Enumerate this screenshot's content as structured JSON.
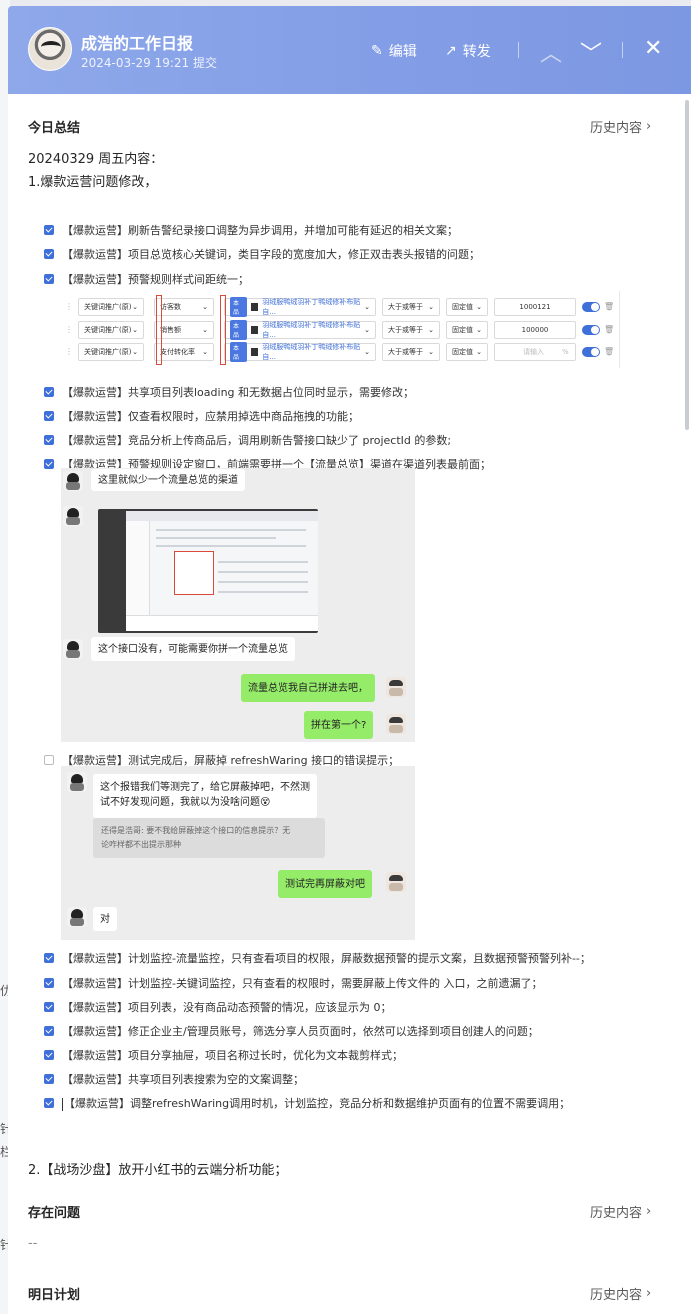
{
  "header": {
    "title": "成浩的工作日报",
    "subtitle": "2024-03-29 19:21 提交",
    "edit_label": "编辑",
    "forward_label": "转发",
    "up_icon": "chevron-up-icon",
    "down_icon": "chevron-down-icon",
    "close_icon": "close-icon"
  },
  "colors": {
    "header_bg": "#839ee6",
    "checkbox": "#3f6fd8",
    "bubble_green": "#95ec69",
    "chat_bg": "#ededed"
  },
  "background_fragments": [
    "仂",
    "针",
    "栏",
    "针"
  ],
  "today": {
    "title": "今日总结",
    "history": "历史内容",
    "date_line": "20240329 周五内容：",
    "item1": "1.爆款运营问题修改，",
    "tasks_a": [
      "【爆款运营】刷新告警纪录接口调整为异步调用，并增加可能有延迟的相关文案；",
      "【爆款运营】项目总览核心关键词，类目字段的宽度加大，修正双击表头报错的问题；",
      "【爆款运营】预警规则样式间距统一；"
    ],
    "rules": [
      {
        "field": "关键词推广(原)",
        "metric": "访客数",
        "tag": "本品",
        "link": "羽绒服鸭绒羽补丁鸭绒修补布贴自...",
        "op": "大于或等于",
        "mode": "固定值",
        "value": "1000121"
      },
      {
        "field": "关键词推广(原)",
        "metric": "销售额",
        "tag": "本品",
        "link": "羽绒服鸭绒羽补丁鸭绒修补布贴自...",
        "op": "大于或等于",
        "mode": "固定值",
        "value": "100000"
      },
      {
        "field": "关键词推广(原)",
        "metric": "支付转化率",
        "tag": "本品",
        "link": "羽绒服鸭绒羽补丁鸭绒修补布贴自...",
        "op": "大于或等于",
        "mode": "固定值",
        "value": "",
        "placeholder": "请输入",
        "unit": "%"
      }
    ],
    "tasks_b": [
      "【爆款运营】共享项目列表loading 和无数据占位同时显示，需要修改；",
      "【爆款运营】仅查看权限时，应禁用掉选中商品拖拽的功能；",
      "【爆款运营】竞品分析上传商品后，调用刷新告警接口缺少了 projectId 的参数;",
      "【爆款运营】预警规则设定窗口，前端需要拼一个【流量总览】渠道在渠道列表最前面；"
    ],
    "chat1": {
      "msg1": "这里就似少一个流量总览的渠道",
      "msg2": "这个接口没有，可能需要你拼一个流量总览",
      "reply1": "流量总览我自己拼进去吧，",
      "reply2": "拼在第一个?"
    },
    "task_unchecked": "【爆款运营】测试完成后，屏蔽掉 refreshWaring 接口的错误提示；",
    "chat2": {
      "msg1_line1": "这个报错我们等测完了，给它屏蔽掉吧，不然测",
      "msg1_line2": "试不好发现问题，我就以为没啥问题😵",
      "quote_line1": "还得是浩哥: 要不我给屏蔽掉这个接口的信息提示？无",
      "quote_line2": "论咋样都不出提示那种",
      "reply": "测试完再屏蔽对吧",
      "msg2": "对"
    },
    "tasks_c": [
      "【爆款运营】计划监控-流量监控，只有查看项目的权限，屏蔽数据预警的提示文案，且数据预警预警列补--；",
      "【爆款运营】计划监控-关键词监控，只有查看的权限时，需要屏蔽上传文件的 入口，之前遗漏了；",
      "【爆款运营】项目列表，没有商品动态预警的情况，应该显示为 0；",
      "【爆款运营】修正企业主/管理员账号，筛选分享人员页面时，依然可以选择到项目创建人的问题；",
      "【爆款运营】项目分享抽屉，项目名称过长时，优化为文本裁剪样式；",
      "【爆款运营】共享项目列表搜索为空的文案调整；",
      "【爆款运营】调整refreshWaring调用时机，计划监控，竞品分析和数据维护页面有的位置不需要调用；"
    ],
    "item2": "2.【战场沙盘】放开小红书的云端分析功能；"
  },
  "problems": {
    "title": "存在问题",
    "history": "历史内容",
    "content": "--"
  },
  "plan": {
    "title": "明日计划",
    "history": "历史内容"
  }
}
